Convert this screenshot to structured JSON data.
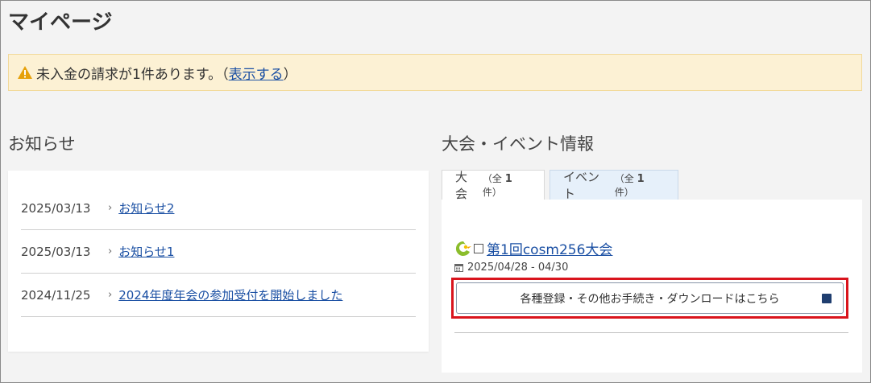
{
  "header": {
    "title": "マイページ"
  },
  "alert": {
    "icon": "warning-icon",
    "text": "未入金の請求が1件あります。（",
    "link": "表示する",
    "suffix": "）",
    "background": "#fcf1d4"
  },
  "news": {
    "title": "お知らせ",
    "items": [
      {
        "date": "2025/03/13",
        "sep": "›",
        "label": "お知らせ2"
      },
      {
        "date": "2025/03/13",
        "sep": "›",
        "label": "お知らせ1"
      },
      {
        "date": "2024/11/25",
        "sep": "›",
        "label": "2024年度年会の参加受付を開始しました"
      }
    ]
  },
  "events": {
    "title": "大会・イベント情報",
    "tabs": [
      {
        "label": "大会",
        "count_prefix": "（全",
        "count": "1",
        "count_suffix": "件）"
      },
      {
        "label": "イベント",
        "count_prefix": "（全",
        "count": "1",
        "count_suffix": "件）"
      }
    ],
    "item": {
      "logo_icon": "bird-logo-icon",
      "external_icon": "external-link-icon",
      "name": "第1回cosm256大会",
      "calendar_icon": "calendar-icon",
      "date": "2025/04/28 - 04/30",
      "button_label": "各種登録・その他お手続き・ダウンロードはこちら"
    },
    "highlight_color": "#d9141d",
    "link_color": "#1a4fa3"
  }
}
